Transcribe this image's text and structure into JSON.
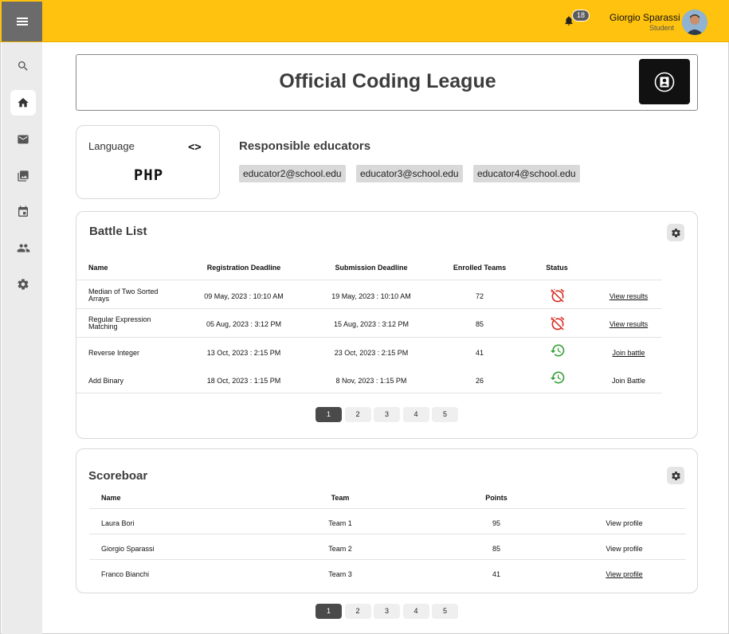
{
  "header": {
    "notification_count": "18",
    "user_name": "Giorgio Sparassi",
    "user_role": "Student"
  },
  "sidebar": {
    "items": [
      {
        "icon": "search-icon"
      },
      {
        "icon": "home-icon",
        "active": true
      },
      {
        "icon": "mail-icon"
      },
      {
        "icon": "gallery-icon"
      },
      {
        "icon": "calendar-icon"
      },
      {
        "icon": "people-icon"
      },
      {
        "icon": "settings-icon"
      }
    ]
  },
  "tournament": {
    "title": "Official Coding League"
  },
  "language": {
    "label": "Language",
    "value": "PHP"
  },
  "educators": {
    "title": "Responsible educators",
    "list": [
      "educator2@school.edu",
      "educator3@school.edu",
      "educator4@school.edu"
    ]
  },
  "battles": {
    "title": "Battle List",
    "columns": [
      "Name",
      "Registration Deadline",
      "Submission Deadline",
      "Enrolled Teams",
      "Status"
    ],
    "rows": [
      {
        "name": "Median of Two Sorted Arrays",
        "registration": "09 May, 2023 : 10:10 AM",
        "submission": "19 May, 2023 : 10:10 AM",
        "teams": "72",
        "status": "closed",
        "action": "View results"
      },
      {
        "name": "Regular Expression Matching",
        "registration": "05 Aug, 2023 : 3:12 PM",
        "submission": "15 Aug, 2023 : 3:12 PM",
        "teams": "85",
        "status": "closed",
        "action": "View results"
      },
      {
        "name": "Reverse Integer",
        "registration": "13 Oct, 2023 : 2:15 PM",
        "submission": "23 Oct, 2023 : 2:15 PM",
        "teams": "41",
        "status": "open",
        "action": "Join battle"
      },
      {
        "name": "Add Binary",
        "registration": "18 Oct, 2023 : 1:15 PM",
        "submission": "8 Nov, 2023 : 1:15 PM",
        "teams": "26",
        "status": "open",
        "action": "Join Battle"
      }
    ],
    "pages": [
      "1",
      "2",
      "3",
      "4",
      "5"
    ],
    "current_page": "1"
  },
  "scoreboard": {
    "title": "Scoreboar",
    "columns": [
      "Name",
      "Team",
      "Points"
    ],
    "rows": [
      {
        "name": "Laura Bori",
        "team": "Team 1",
        "points": "95",
        "action": "View profile"
      },
      {
        "name": "Giorgio Sparassi",
        "team": "Team 2",
        "points": "85",
        "action": "View profile"
      },
      {
        "name": "Franco Bianchi",
        "team": "Team 3",
        "points": "41",
        "action": "View profile"
      }
    ],
    "pages": [
      "1",
      "2",
      "3",
      "4",
      "5"
    ],
    "current_page": "1"
  },
  "colors": {
    "topbar": "#FFC20E",
    "closed_status": "#d93025",
    "open_status": "#3aa13a"
  }
}
